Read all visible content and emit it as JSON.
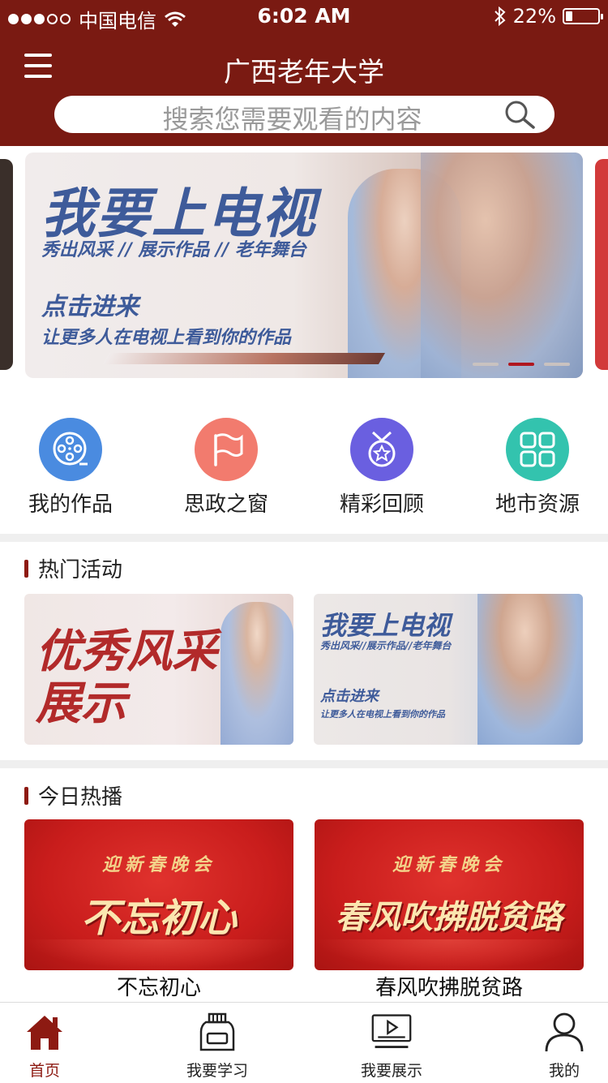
{
  "status_bar": {
    "carrier": "中国电信",
    "time": "6:02 AM",
    "battery": "22%",
    "battery_level": 0.22
  },
  "header": {
    "title": "广西老年大学",
    "search_placeholder": "搜索您需要观看的内容"
  },
  "banner": {
    "title": "我要上电视",
    "subtitle": "秀出风采 // 展示作品 // 老年舞台",
    "cta": "点击进来",
    "desc": "让更多人在电视上看到你的作品",
    "active_index": 1,
    "count": 3
  },
  "quick_nav": [
    {
      "label": "我的作品",
      "icon": "film-reel-icon",
      "color": "#4a8be0"
    },
    {
      "label": "思政之窗",
      "icon": "flag-icon",
      "color": "#f27b6e"
    },
    {
      "label": "精彩回顾",
      "icon": "medal-star-icon",
      "color": "#6a5fe0"
    },
    {
      "label": "地市资源",
      "icon": "grid-icon",
      "color": "#33c3ae"
    }
  ],
  "hot_activities": {
    "heading": "热门活动",
    "items": [
      {
        "text": "优秀风采展示"
      },
      {
        "title": "我要上电视",
        "subtitle": "秀出风采//展示作品//老年舞台",
        "cta": "点击进来",
        "desc": "让更多人在电视上看到你的作品"
      }
    ]
  },
  "today_hot": {
    "heading": "今日热播",
    "items": [
      {
        "kicker": "迎新春晚会",
        "headline": "不忘初心",
        "caption": "不忘初心"
      },
      {
        "kicker": "迎新春晚会",
        "headline": "春风吹拂脱贫路",
        "caption": "春风吹拂脱贫路"
      }
    ]
  },
  "tabbar": [
    {
      "label": "首页",
      "icon": "home-icon",
      "active": true
    },
    {
      "label": "我要学习",
      "icon": "ink-bottle-icon",
      "active": false
    },
    {
      "label": "我要展示",
      "icon": "play-screen-icon",
      "active": false
    },
    {
      "label": "我的",
      "icon": "user-icon",
      "active": false
    }
  ],
  "colors": {
    "brand": "#7a1a12",
    "accent": "#8d1a12",
    "indicator_active": "#b0171f"
  }
}
